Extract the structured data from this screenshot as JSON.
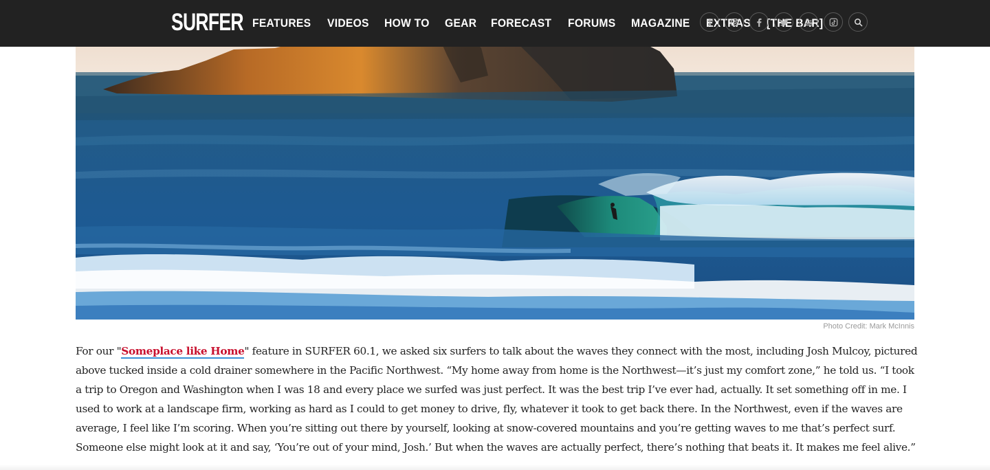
{
  "header": {
    "logo": "SURFER",
    "nav": [
      "FEATURES",
      "VIDEOS",
      "HOW TO",
      "GEAR",
      "FORECAST",
      "FORUMS",
      "MAGAZINE",
      "EXTRAS",
      "[THE BAR]"
    ],
    "icons": [
      "accessibility-icon",
      "instagram-icon",
      "facebook-icon",
      "twitter-icon",
      "youtube-icon",
      "tiktok-icon",
      "search-icon"
    ]
  },
  "hero": {
    "credit": "Photo Credit: Mark McInnis"
  },
  "article": {
    "lead_before": "For our \"",
    "link_text": "Someplace like Home",
    "lead_after": "\" feature in SURFER 60.1, we asked six surfers to talk about the waves they connect with the most, including Josh Mulcoy, pictured above tucked inside a cold drainer somewhere in the Pacific Northwest. “My home away from home is the Northwest—it’s just my comfort zone,” he told us. “I took a trip to Oregon and Washington when I was 18 and every place we surfed was just perfect. It was the best trip I’ve ever had, actually. It set something off in me. I used to work at a landscape firm, working as hard as I could to get money to drive, fly, whatever it took to get back there. In the Northwest, even if the waves are average, I feel like I’m scoring. When you’re sitting out there by yourself, looking at snow-covered mountains and you’re getting waves to me that’s perfect surf. Someone else might look at it and say, ‘You’re out of your mind, Josh.’ But when the waves are actually perfect, there’s nothing that beats it. It makes me feel alive.”"
  },
  "colors": {
    "header_bg": "#222222",
    "link": "#c8102e",
    "link_underline": "#3a8fd6",
    "body_text": "#222222"
  }
}
